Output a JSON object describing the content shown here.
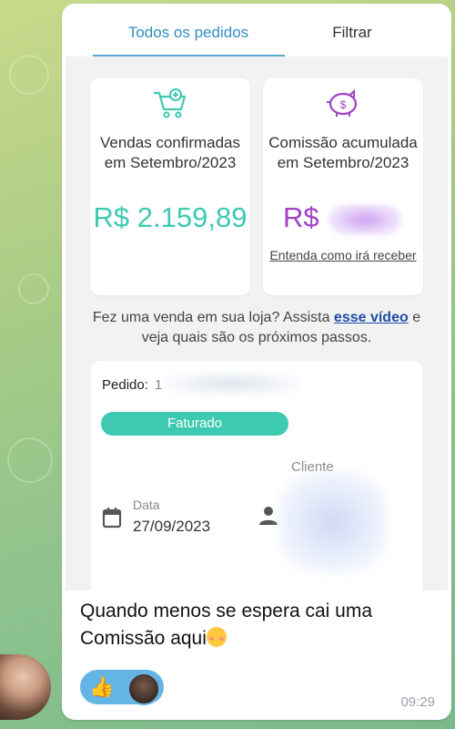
{
  "tabs": {
    "all_orders": "Todos os pedidos",
    "filter": "Filtrar"
  },
  "sales_card": {
    "icon": "cart-icon",
    "label": "Vendas confirmadas em Setembro/2023",
    "amount": "R$ 2.159,89"
  },
  "commission_card": {
    "icon": "piggy-bank-icon",
    "label": "Comissão acumulada em Setembro/2023",
    "amount_prefix": "R$",
    "link": "Entenda como irá receber"
  },
  "hint": {
    "before": "Fez uma venda em sua loja? Assista ",
    "link": "esse vídeo",
    "after": " e veja quais são os próximos passos."
  },
  "order": {
    "label": "Pedido:",
    "number_visible": "1",
    "status": "Faturado",
    "client_caption": "Cliente",
    "date_caption": "Data",
    "date_value": "27/09/2023"
  },
  "message": {
    "text": "Quando menos se espera cai uma Comissão aqui",
    "time": "09:29"
  },
  "reaction": {
    "emoji": "👍"
  },
  "colors": {
    "accent_teal": "#3ec9b1",
    "accent_purple": "#a043c7",
    "tab_blue": "#2f8fbf"
  }
}
